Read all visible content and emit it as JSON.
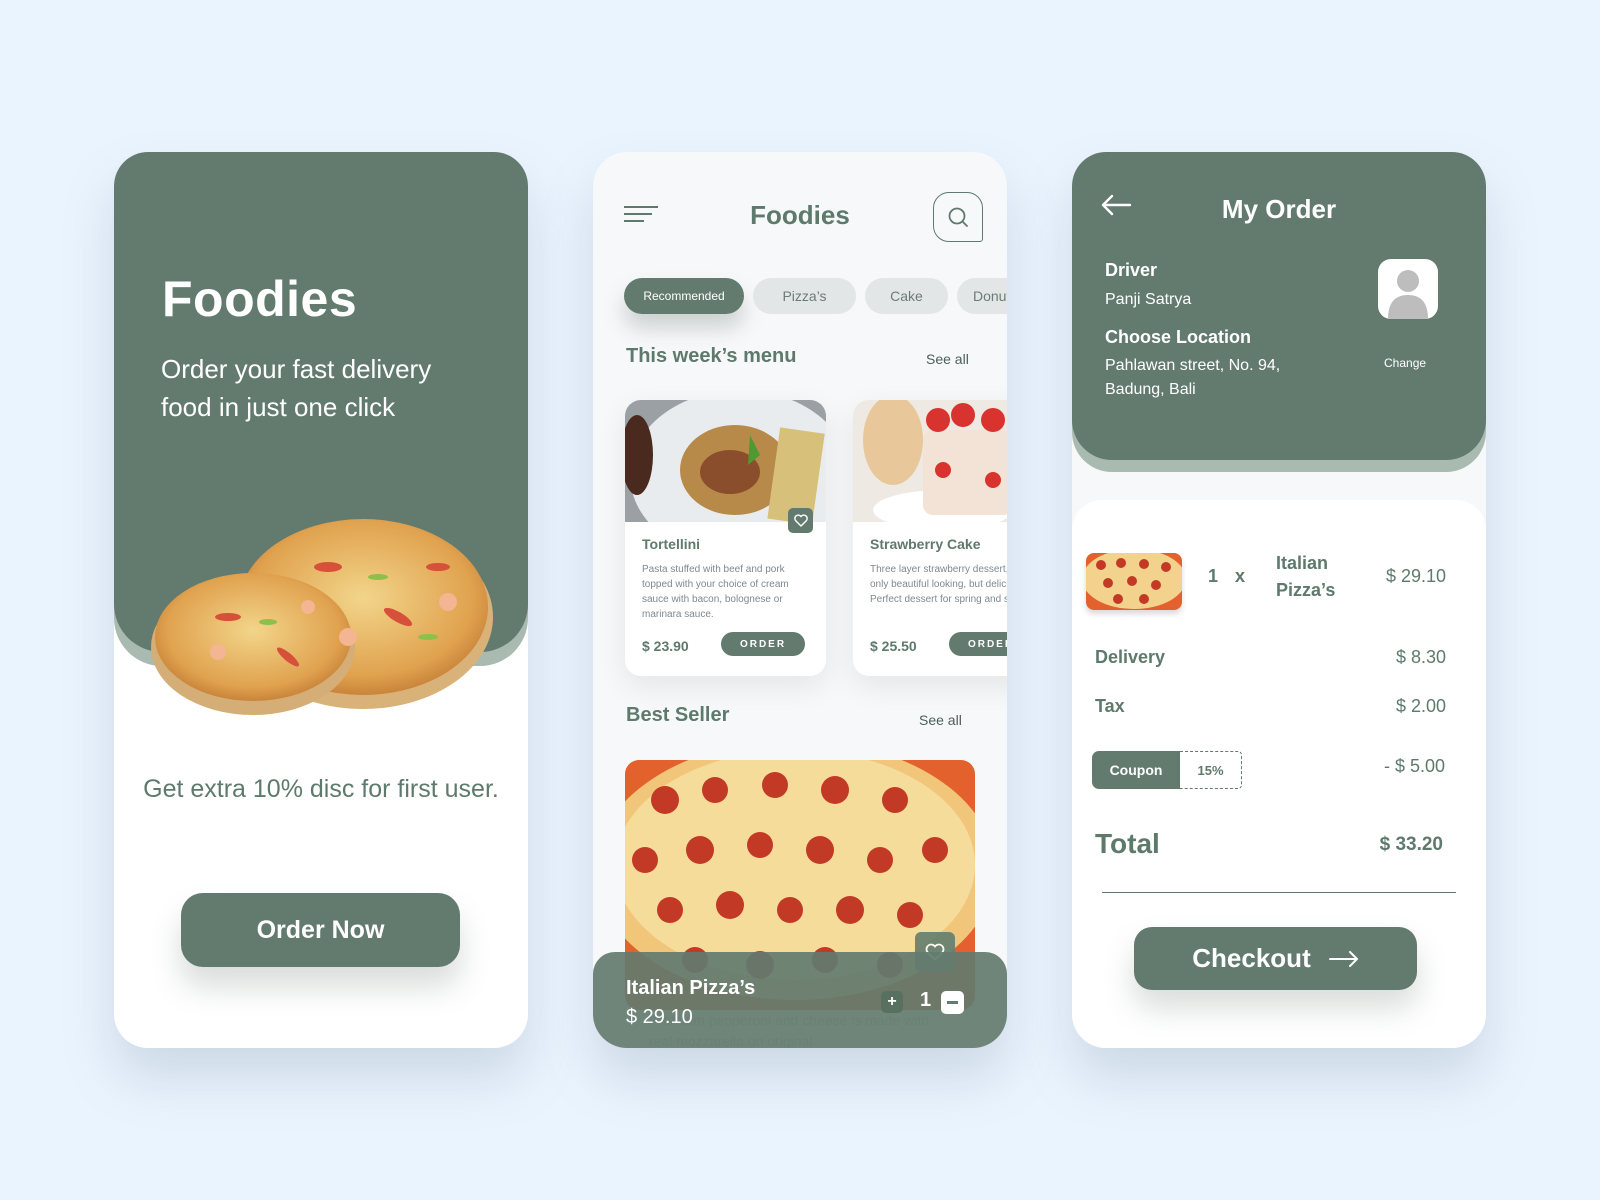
{
  "colors": {
    "brand_green": "#637b6f",
    "background": "#eaf4fe",
    "accent_light": "#a9bab1"
  },
  "onboarding": {
    "title": "Foodies",
    "subtitle": "Order your fast delivery food in just one click",
    "promo": "Get extra 10% disc for first user.",
    "order_button": "Order Now",
    "hero_image": "pizza-image"
  },
  "home": {
    "app_title": "Foodies",
    "menu_icon": "hamburger-menu-icon",
    "search_icon": "search-icon",
    "categories": [
      {
        "label": "Recommended",
        "active": true
      },
      {
        "label": "Pizza’s",
        "active": false
      },
      {
        "label": "Cake",
        "active": false
      },
      {
        "label": "Donut",
        "active": false
      }
    ],
    "weekly_menu": {
      "title": "This week’s menu",
      "see_all": "See all",
      "items": [
        {
          "name": "Tortellini",
          "description": "Pasta stuffed with beef and pork topped with your choice of cream sauce with bacon, bolognese or marinara sauce.",
          "price": "$ 23.90",
          "order_label": "ORDER"
        },
        {
          "name": "Strawberry Cake",
          "description": "Three layer strawberry dessert, not only beautiful looking, but delicious! Perfect dessert for spring and summer.",
          "price": "$ 25.50",
          "order_label": "ORDER"
        }
      ]
    },
    "best_seller": {
      "title": "Best Seller",
      "see_all": "See all",
      "ghost_description": "Premium pepperoni and cheese is made with real mozzarella on original"
    },
    "cart_bar": {
      "name": "Italian Pizza’s",
      "price": "$ 29.10",
      "quantity": "1",
      "plus": "+"
    }
  },
  "order": {
    "title": "My Order",
    "driver_label": "Driver",
    "driver_name": "Panji Satrya",
    "location_label": "Choose Location",
    "location_line1": "Pahlawan street, No. 94,",
    "location_line2": "Badung, Bali",
    "change_label": "Change",
    "item": {
      "qty": "1",
      "times": "x",
      "name_line1": "Italian",
      "name_line2": "Pizza’s",
      "price": "$ 29.10"
    },
    "delivery_label": "Delivery",
    "delivery_value": "$ 8.30",
    "tax_label": "Tax",
    "tax_value": "$ 2.00",
    "coupon_label": "Coupon",
    "coupon_value": "15%",
    "coupon_discount": "- $ 5.00",
    "total_label": "Total",
    "total_value": "$ 33.20",
    "checkout_label": "Checkout"
  }
}
